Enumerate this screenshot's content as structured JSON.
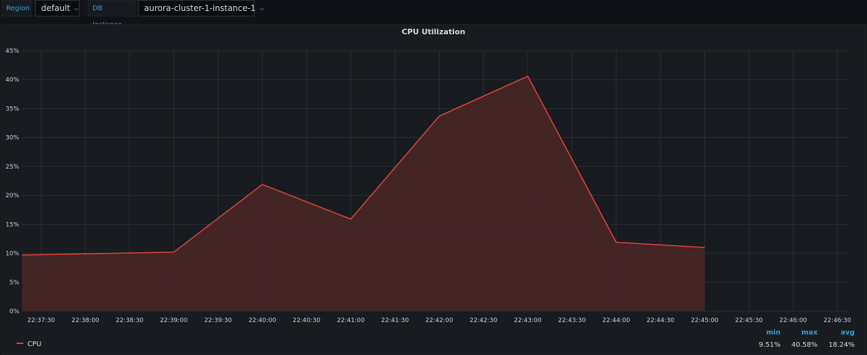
{
  "variables": {
    "region": {
      "label": "Region",
      "value": "default"
    },
    "db_instance": {
      "label": "DB Instance",
      "value": "aurora-cluster-1-instance-1"
    }
  },
  "panel": {
    "title": "CPU Utilization"
  },
  "legend": {
    "series_name": "CPU",
    "headers": {
      "min": "min",
      "max": "max",
      "avg": "avg"
    },
    "values": {
      "min": "9.51%",
      "max": "40.58%",
      "avg": "18.24%"
    }
  },
  "colors": {
    "series": "#e0453c",
    "fill": "#4a2626",
    "grid": "#2c3037",
    "accent": "#33a2e5"
  },
  "chart_data": {
    "type": "area",
    "title": "CPU Utilization",
    "ylim": [
      0,
      45
    ],
    "y_ticks": [
      "0%",
      "5%",
      "10%",
      "15%",
      "20%",
      "25%",
      "30%",
      "35%",
      "40%",
      "45%"
    ],
    "x_ticks": [
      "22:37:30",
      "22:38:00",
      "22:38:30",
      "22:39:00",
      "22:39:30",
      "22:40:00",
      "22:40:30",
      "22:41:00",
      "22:41:30",
      "22:42:00",
      "22:42:30",
      "22:43:00",
      "22:43:30",
      "22:44:00",
      "22:44:30",
      "22:45:00",
      "22:45:30",
      "22:46:00",
      "22:46:30"
    ],
    "x_range": [
      "22:37:17",
      "22:46:38"
    ],
    "grid": true,
    "legend_position": "bottom-left",
    "series": [
      {
        "name": "CPU",
        "points": [
          {
            "x": "22:37:17",
            "y": 9.7
          },
          {
            "x": "22:38:00",
            "y": 9.9
          },
          {
            "x": "22:39:00",
            "y": 10.2
          },
          {
            "x": "22:40:00",
            "y": 21.9
          },
          {
            "x": "22:41:00",
            "y": 15.9
          },
          {
            "x": "22:42:00",
            "y": 33.7
          },
          {
            "x": "22:43:00",
            "y": 40.6
          },
          {
            "x": "22:44:00",
            "y": 11.9
          },
          {
            "x": "22:45:00",
            "y": 11.0
          }
        ]
      }
    ]
  }
}
